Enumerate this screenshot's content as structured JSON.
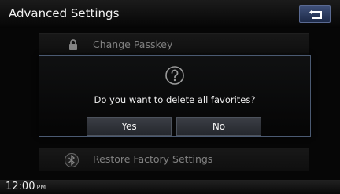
{
  "header": {
    "title": "Advanced Settings",
    "back_icon": "back-arrow-icon"
  },
  "menu": {
    "items": [
      {
        "label": "Change Passkey",
        "icon": "lock-icon"
      },
      {
        "label": "Restore Factory Settings",
        "icon": "bluetooth-icon"
      }
    ]
  },
  "dialog": {
    "icon": "question-icon",
    "message": "Do you want to delete all favorites?",
    "yes_label": "Yes",
    "no_label": "No"
  },
  "status": {
    "time": "12:00",
    "meridiem": "PM"
  },
  "colors": {
    "back_button": "#2c3a5e",
    "dialog_border": "#4b5a72"
  }
}
